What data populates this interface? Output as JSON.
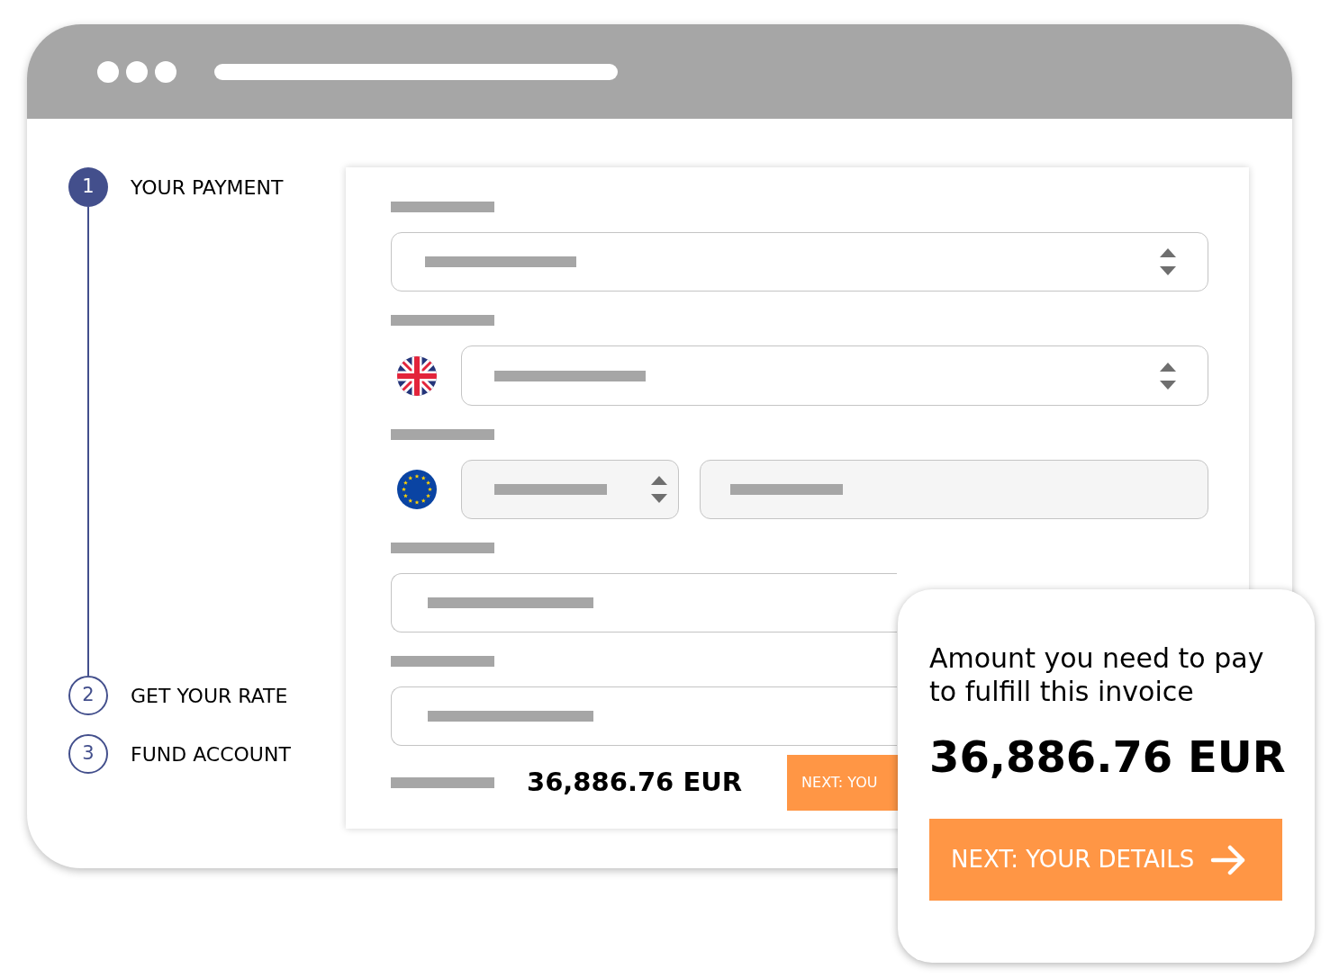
{
  "steps": [
    {
      "number": "1",
      "label": "YOUR PAYMENT",
      "selected": true
    },
    {
      "number": "2",
      "label": "GET YOUR RATE",
      "selected": false
    },
    {
      "number": "3",
      "label": "FUND ACCOUNT",
      "selected": false
    }
  ],
  "form": {
    "fields": [
      {
        "kind": "select"
      },
      {
        "kind": "country_select"
      },
      {
        "kind": "currency_amount"
      },
      {
        "kind": "input"
      },
      {
        "kind": "input"
      }
    ],
    "total": "36,886.76 EUR",
    "button": "NEXT: YOU"
  },
  "summary": {
    "text": "Amount you need to pay to fulfill this invoice",
    "amount": "36,886.76 EUR",
    "button": "NEXT: YOUR DETAILS"
  }
}
